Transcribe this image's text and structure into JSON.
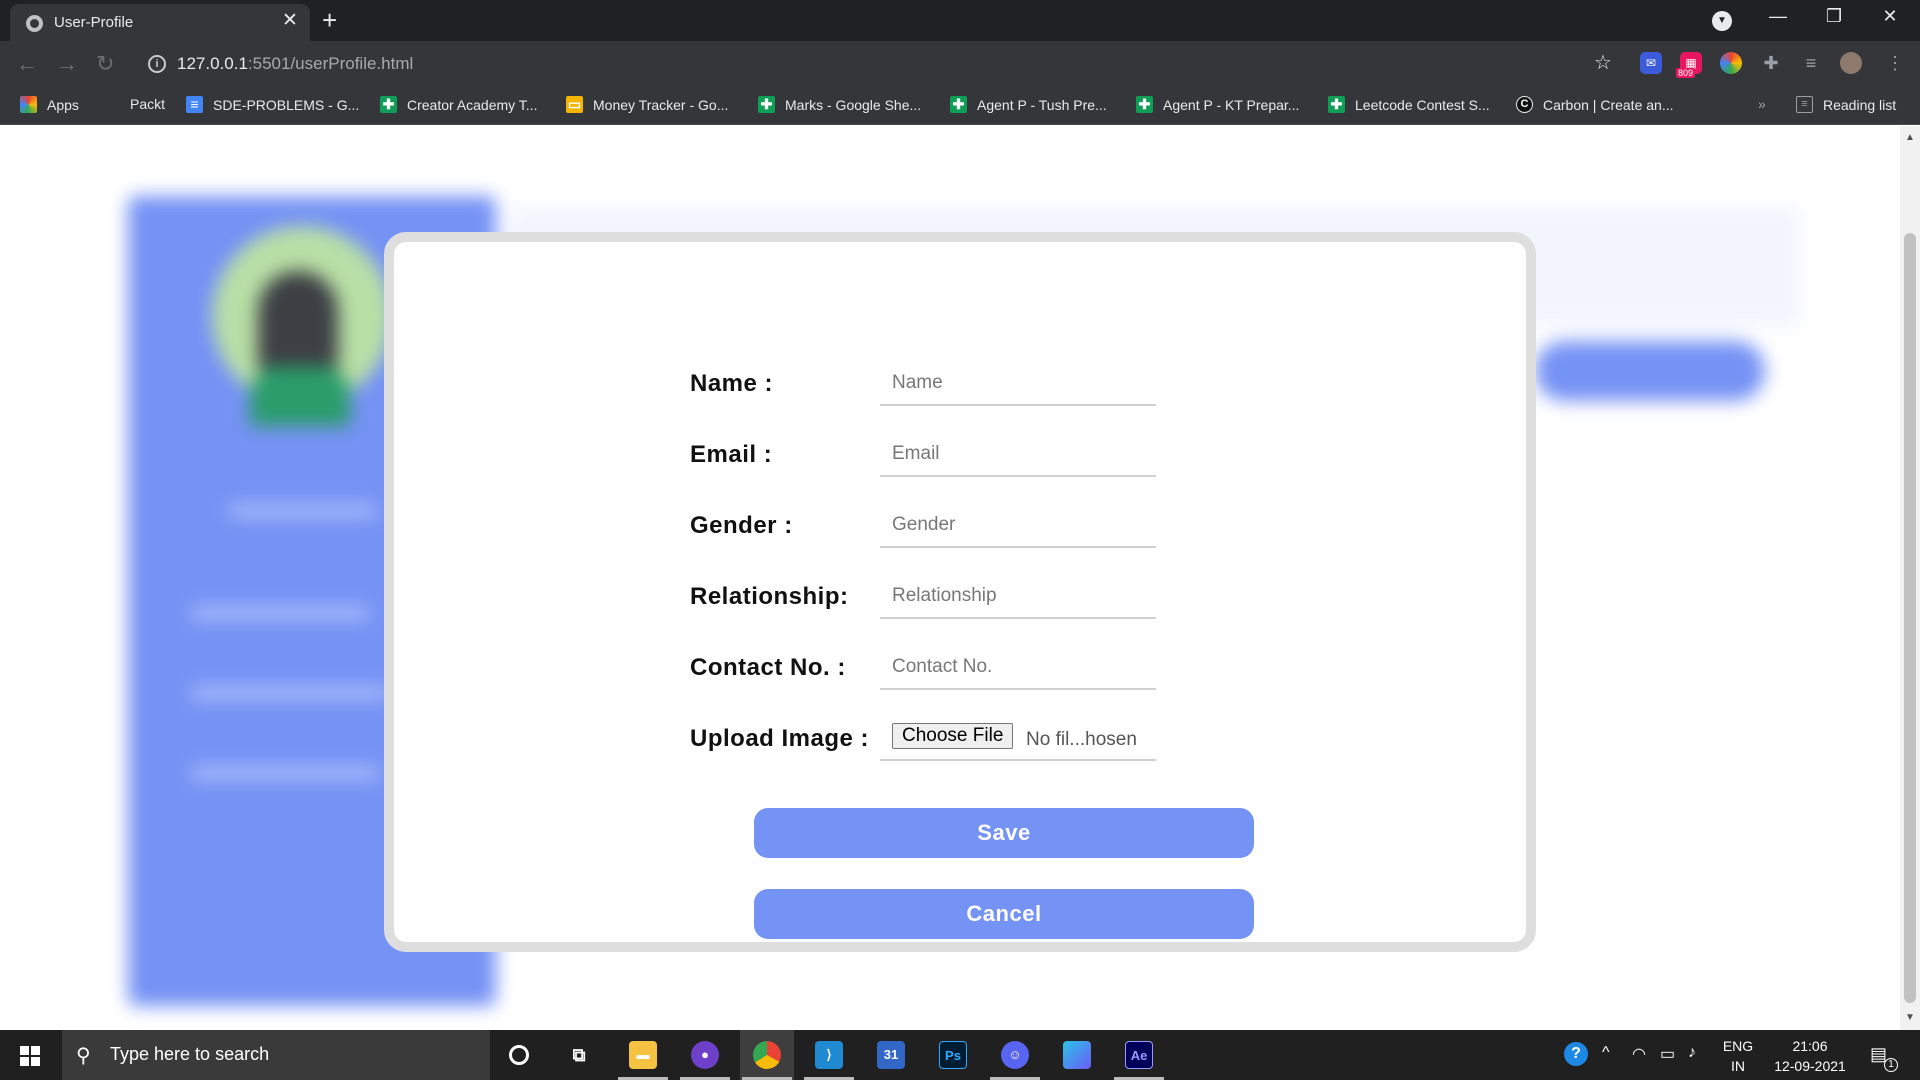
{
  "browser": {
    "tab_title": "User-Profile",
    "tab_close": "✕",
    "new_tab": "+",
    "url_host": "127.0.0.1",
    "url_path": ":5501/userProfile.html",
    "ext_badge": "809",
    "window_controls": {
      "minimize": "—",
      "restore": "❐",
      "close": "✕"
    }
  },
  "bookmarks": [
    {
      "label": "Apps",
      "icon": "apps-grid-icon",
      "color": "#e94235"
    },
    {
      "label": "Packt",
      "icon": "none",
      "color": "#35363a"
    },
    {
      "label": "SDE-PROBLEMS - G...",
      "icon": "google-docs-icon",
      "color": "#4285f4"
    },
    {
      "label": "Creator Academy T...",
      "icon": "google-sheets-icon",
      "color": "#0f9d58"
    },
    {
      "label": "Money Tracker - Go...",
      "icon": "google-slides-icon",
      "color": "#f4b400"
    },
    {
      "label": "Marks - Google She...",
      "icon": "google-sheets-icon",
      "color": "#0f9d58"
    },
    {
      "label": "Agent P - Tush Pre...",
      "icon": "google-sheets-icon",
      "color": "#0f9d58"
    },
    {
      "label": "Agent P - KT Prepar...",
      "icon": "google-sheets-icon",
      "color": "#0f9d58"
    },
    {
      "label": "Leetcode Contest S...",
      "icon": "google-sheets-icon",
      "color": "#0f9d58"
    },
    {
      "label": "Carbon | Create an...",
      "icon": "carbon-icon",
      "color": "#111111"
    }
  ],
  "reading_list": "Reading list",
  "overflow": "»",
  "modal": {
    "fields": [
      {
        "label": "Name :",
        "placeholder": "Name"
      },
      {
        "label": "Email :",
        "placeholder": "Email"
      },
      {
        "label": "Gender :",
        "placeholder": "Gender"
      },
      {
        "label": "Relationship:",
        "placeholder": "Relationship"
      },
      {
        "label": "Contact No. :",
        "placeholder": "Contact No."
      }
    ],
    "upload": {
      "label": "Upload Image :",
      "button": "Choose File",
      "status": "No fil...hosen"
    },
    "save_label": "Save",
    "cancel_label": "Cancel"
  },
  "taskbar": {
    "search_placeholder": "Type here to search",
    "lang_top": "ENG",
    "lang_bottom": "IN",
    "time": "21:06",
    "date": "12-09-2021",
    "notification_count": "1",
    "calendar_day": "31",
    "photoshop": "Ps",
    "after_effects": "Ae"
  },
  "colors": {
    "accent": "#7592f5",
    "chrome_dark": "#202124",
    "chrome_toolbar": "#35363a",
    "taskbar": "#202020"
  }
}
